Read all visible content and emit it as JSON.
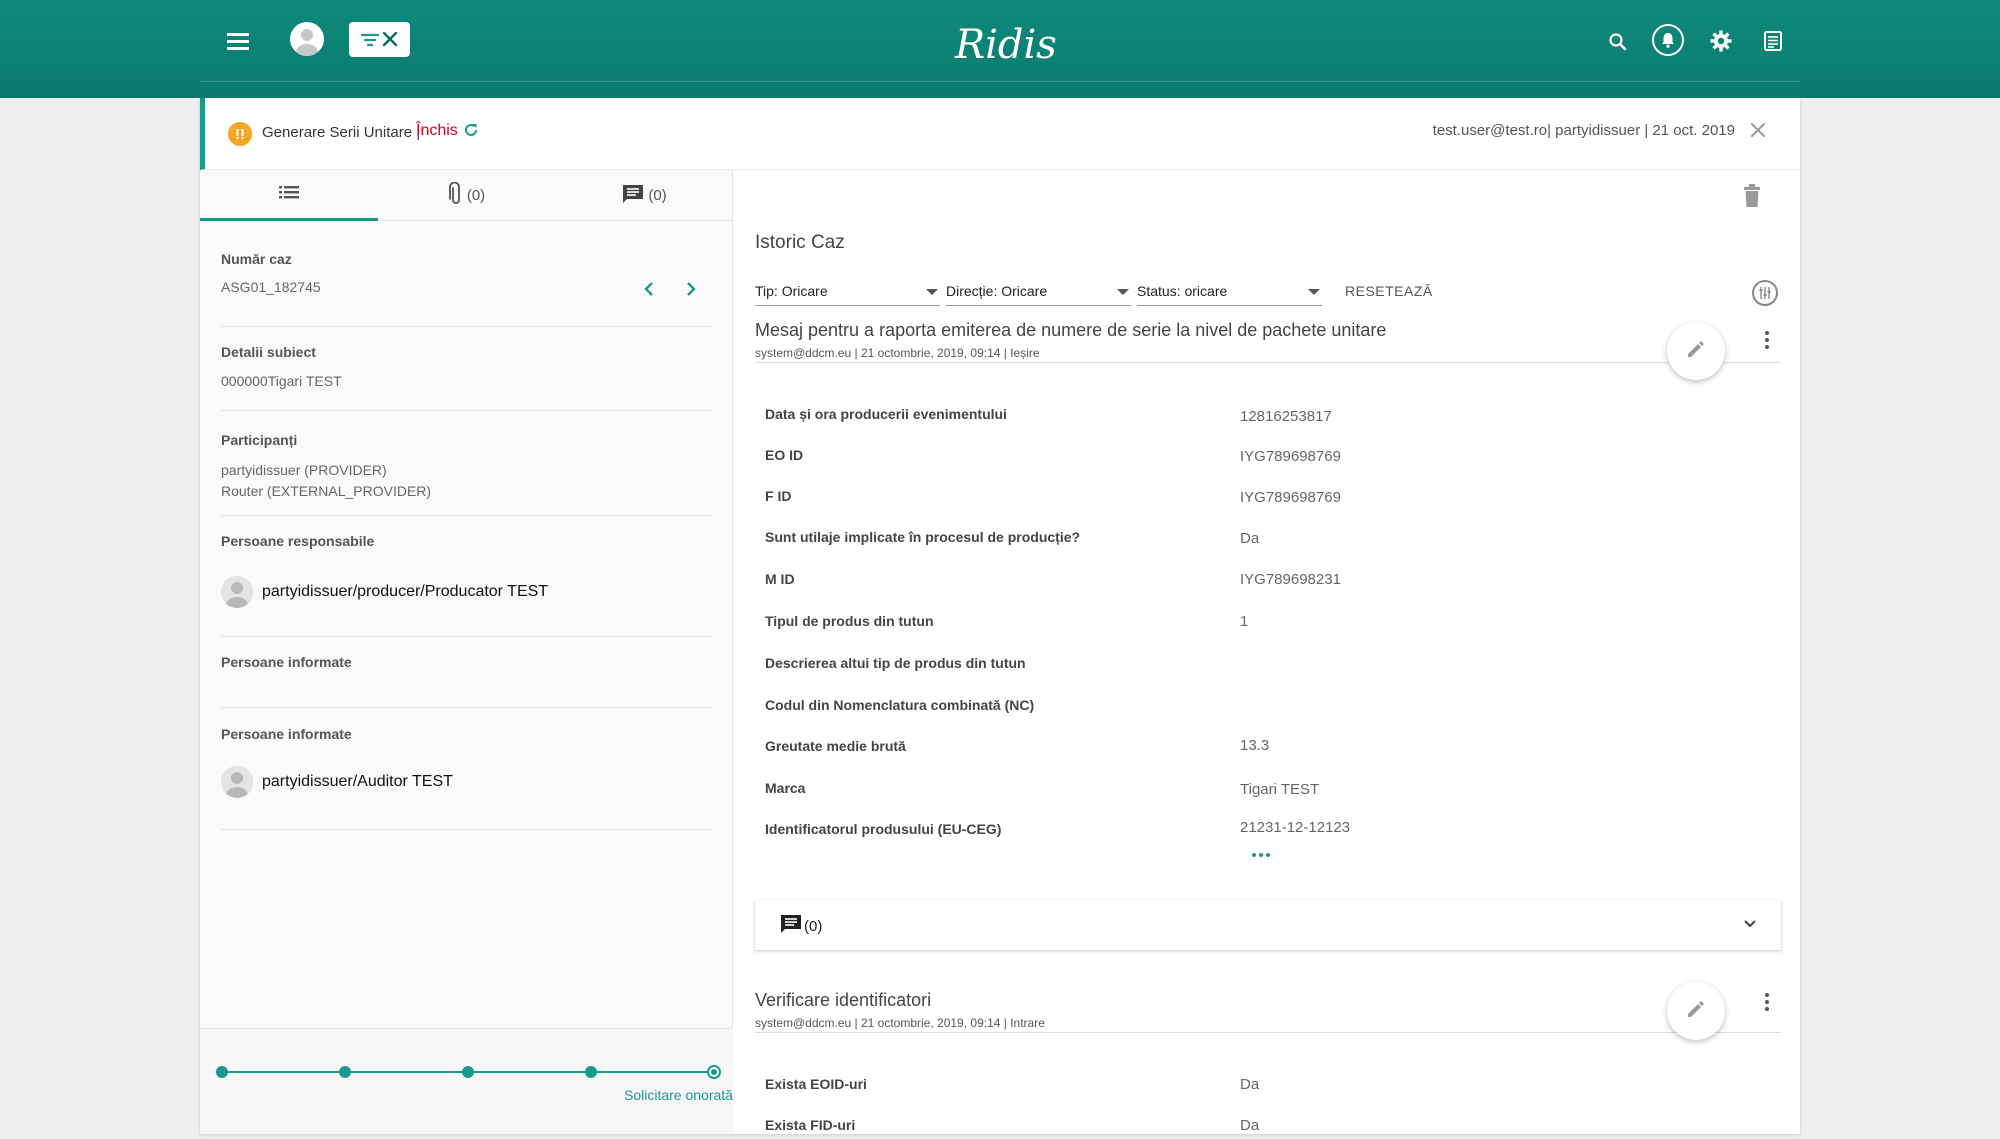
{
  "header": {
    "logo": "Ridis",
    "icons": [
      "menu-icon",
      "avatar-icon",
      "filter-clear-icon",
      "search-icon",
      "notifications-icon",
      "settings-icon",
      "document-icon"
    ]
  },
  "case": {
    "type_label": "Generare Serii Unitare |",
    "status": "Închis",
    "user_meta": "test.user@test.ro| partyidissuer | 21 oct. 2019",
    "colors": {
      "accent": "#1a9a8a",
      "status": "#d0021b",
      "warning": "#f5a623"
    }
  },
  "left_tabs": {
    "details_icon": "list-icon",
    "attachments_count": "(0)",
    "comments_count": "(0)"
  },
  "details": {
    "case_number_label": "Număr caz",
    "case_number": "ASG01_182745",
    "subject_label": "Detalii subiect",
    "subject": "000000Tigari TEST",
    "participants_label": "Participanți",
    "participants": [
      "partyidissuer (PROVIDER)",
      "Router (EXTERNAL_PROVIDER)"
    ],
    "responsible_label": "Persoane responsabile",
    "responsible": [
      "partyidissuer/producer/Producator TEST"
    ],
    "informed_label_1": "Persoane informate",
    "informed_label_2": "Persoane informate",
    "informed": [
      "partyidissuer/Auditor TEST"
    ]
  },
  "workflow": {
    "current_step_label": "Solicitare onorată"
  },
  "history": {
    "title": "Istoric Caz",
    "filters": {
      "type": "Tip: Oricare",
      "direction": "Direcție: Oricare",
      "status": "Status: oricare",
      "reset": "RESETEAZĂ"
    },
    "messages": [
      {
        "title": "Mesaj pentru a raporta emiterea de numere de serie la nivel de pachete unitare",
        "subtitle": "system@ddcm.eu | 21 octombrie, 2019, 09:14 | Ieșire",
        "fields": [
          {
            "label": "Data și ora producerii evenimentului",
            "value": "12816253817"
          },
          {
            "label": "EO ID",
            "value": "IYG789698769"
          },
          {
            "label": "F ID",
            "value": "IYG789698769"
          },
          {
            "label": "Sunt utilaje implicate în procesul de producție?",
            "value": "Da"
          },
          {
            "label": "M ID",
            "value": "IYG789698231"
          },
          {
            "label": "Tipul de produs din tutun",
            "value": "1"
          },
          {
            "label": "Descrierea altui tip de produs din tutun",
            "value": ""
          },
          {
            "label": "Codul din Nomenclatura combinată (NC)",
            "value": ""
          },
          {
            "label": "Greutate medie brută",
            "value": "13.3"
          },
          {
            "label": "Marca",
            "value": "Tigari TEST"
          },
          {
            "label": "Identificatorul produsului (EU-CEG)",
            "value": "21231-12-12123"
          }
        ],
        "comments_count": "(0)"
      },
      {
        "title": "Verificare identificatori",
        "subtitle": "system@ddcm.eu | 21 octombrie, 2019, 09:14 | Intrare",
        "fields": [
          {
            "label": "Exista EOID-uri",
            "value": "Da"
          },
          {
            "label": "Exista FID-uri",
            "value": "Da"
          }
        ]
      }
    ]
  }
}
